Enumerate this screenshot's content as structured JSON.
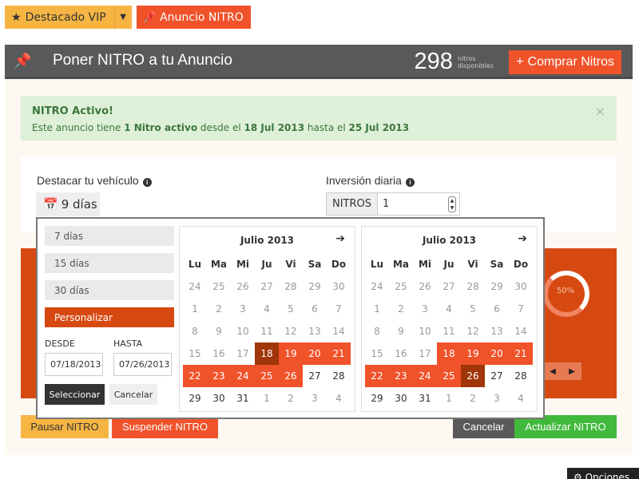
{
  "top_buttons": {
    "vip_label": "Destacado VIP",
    "nitro_label": "Anuncio NITRO"
  },
  "header": {
    "title": "Poner NITRO a tu Anuncio",
    "nitro_count": "298",
    "nitro_count_label_1": "nitros",
    "nitro_count_label_2": "disponibles",
    "buy_label": "Comprar Nitros"
  },
  "alert": {
    "title": "NITRO Activo!",
    "text_prefix": "Este anuncio tiene ",
    "nitro_active": "1 Nitro activo",
    "text_mid": " desde el ",
    "date_from": "18 Jul 2013",
    "text_mid2": " hasta el ",
    "date_to": "25 Jul 2013",
    "close": "×"
  },
  "form": {
    "highlight_label": "Destacar tu vehículo",
    "days_value": "9 días",
    "investment_label": "Inversión diaria",
    "nitros_addon": "NITROS",
    "nitros_value": "1"
  },
  "datepicker": {
    "presets": [
      "7 días",
      "15 días",
      "30 días",
      "Personalizar"
    ],
    "from_label": "DESDE",
    "to_label": "HASTA",
    "from_value": "07/18/2013",
    "to_value": "07/26/2013",
    "select_label": "Seleccionar",
    "cancel_label": "Cancelar",
    "weekdays": [
      "Lu",
      "Ma",
      "Mi",
      "Ju",
      "Vi",
      "Sa",
      "Do"
    ],
    "calendars": [
      {
        "month": "Julio 2013",
        "weeks": [
          [
            {
              "d": "24",
              "s": "off"
            },
            {
              "d": "25",
              "s": "off"
            },
            {
              "d": "26",
              "s": "off"
            },
            {
              "d": "27",
              "s": "off"
            },
            {
              "d": "28",
              "s": "off"
            },
            {
              "d": "29",
              "s": "off"
            },
            {
              "d": "30",
              "s": "off"
            }
          ],
          [
            {
              "d": "1",
              "s": "off"
            },
            {
              "d": "2",
              "s": "off"
            },
            {
              "d": "3",
              "s": "off"
            },
            {
              "d": "4",
              "s": "off"
            },
            {
              "d": "5",
              "s": "off"
            },
            {
              "d": "6",
              "s": "off"
            },
            {
              "d": "7",
              "s": "off"
            }
          ],
          [
            {
              "d": "8",
              "s": "off"
            },
            {
              "d": "9",
              "s": "off"
            },
            {
              "d": "10",
              "s": "off"
            },
            {
              "d": "11",
              "s": "off"
            },
            {
              "d": "12",
              "s": "off"
            },
            {
              "d": "13",
              "s": "off"
            },
            {
              "d": "14",
              "s": "off"
            }
          ],
          [
            {
              "d": "15",
              "s": "off"
            },
            {
              "d": "16",
              "s": "off"
            },
            {
              "d": "17",
              "s": "off"
            },
            {
              "d": "18",
              "s": "edge"
            },
            {
              "d": "19",
              "s": "range"
            },
            {
              "d": "20",
              "s": "range"
            },
            {
              "d": "21",
              "s": "range"
            }
          ],
          [
            {
              "d": "22",
              "s": "range"
            },
            {
              "d": "23",
              "s": "range"
            },
            {
              "d": "24",
              "s": "range"
            },
            {
              "d": "25",
              "s": "range"
            },
            {
              "d": "26",
              "s": "range"
            },
            {
              "d": "27",
              "s": ""
            },
            {
              "d": "28",
              "s": ""
            }
          ],
          [
            {
              "d": "29",
              "s": ""
            },
            {
              "d": "30",
              "s": ""
            },
            {
              "d": "31",
              "s": ""
            },
            {
              "d": "1",
              "s": "off"
            },
            {
              "d": "2",
              "s": "off"
            },
            {
              "d": "3",
              "s": "off"
            },
            {
              "d": "4",
              "s": "off"
            }
          ]
        ]
      },
      {
        "month": "Julio 2013",
        "weeks": [
          [
            {
              "d": "24",
              "s": "off"
            },
            {
              "d": "25",
              "s": "off"
            },
            {
              "d": "26",
              "s": "off"
            },
            {
              "d": "27",
              "s": "off"
            },
            {
              "d": "28",
              "s": "off"
            },
            {
              "d": "29",
              "s": "off"
            },
            {
              "d": "30",
              "s": "off"
            }
          ],
          [
            {
              "d": "1",
              "s": "off"
            },
            {
              "d": "2",
              "s": "off"
            },
            {
              "d": "3",
              "s": "off"
            },
            {
              "d": "4",
              "s": "off"
            },
            {
              "d": "5",
              "s": "off"
            },
            {
              "d": "6",
              "s": "off"
            },
            {
              "d": "7",
              "s": "off"
            }
          ],
          [
            {
              "d": "8",
              "s": "off"
            },
            {
              "d": "9",
              "s": "off"
            },
            {
              "d": "10",
              "s": "off"
            },
            {
              "d": "11",
              "s": "off"
            },
            {
              "d": "12",
              "s": "off"
            },
            {
              "d": "13",
              "s": "off"
            },
            {
              "d": "14",
              "s": "off"
            }
          ],
          [
            {
              "d": "15",
              "s": "off"
            },
            {
              "d": "16",
              "s": "off"
            },
            {
              "d": "17",
              "s": "off"
            },
            {
              "d": "18",
              "s": "range"
            },
            {
              "d": "19",
              "s": "range"
            },
            {
              "d": "20",
              "s": "range"
            },
            {
              "d": "21",
              "s": "range"
            }
          ],
          [
            {
              "d": "22",
              "s": "range"
            },
            {
              "d": "23",
              "s": "range"
            },
            {
              "d": "24",
              "s": "range"
            },
            {
              "d": "25",
              "s": "range"
            },
            {
              "d": "26",
              "s": "edge"
            },
            {
              "d": "27",
              "s": ""
            },
            {
              "d": "28",
              "s": ""
            }
          ],
          [
            {
              "d": "29",
              "s": ""
            },
            {
              "d": "30",
              "s": ""
            },
            {
              "d": "31",
              "s": ""
            },
            {
              "d": "1",
              "s": "off"
            },
            {
              "d": "2",
              "s": "off"
            },
            {
              "d": "3",
              "s": "off"
            },
            {
              "d": "4",
              "s": "off"
            }
          ]
        ]
      }
    ]
  },
  "gauge": {
    "value": "50%"
  },
  "footer": {
    "pause_label": "Pausar NITRO",
    "suspend_label": "Suspender NITRO",
    "cancel_label": "Cancelar",
    "update_label": "Actualizar NITRO"
  },
  "options_label": "Opciones",
  "colors": {
    "accent_orange": "#f0522a",
    "dark_orange": "#d64a12",
    "range_edge": "#a0360a",
    "vip_yellow": "#f6b543",
    "header_gray": "#595959",
    "success_green": "#40b93c"
  }
}
